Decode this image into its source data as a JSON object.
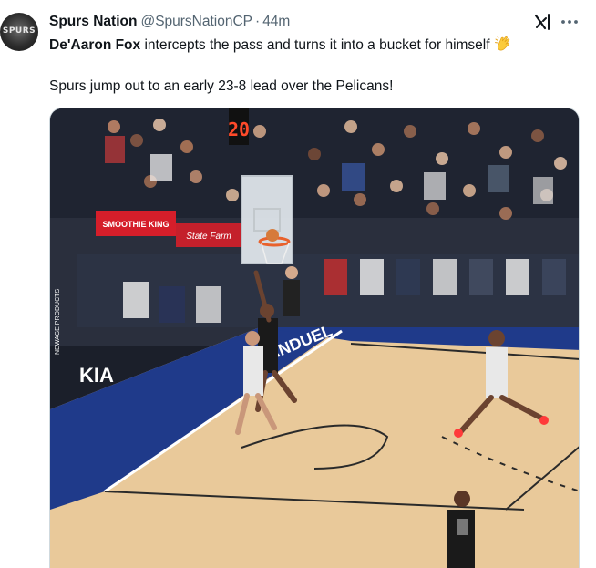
{
  "author": {
    "display_name": "Spurs Nation",
    "handle": "@SpursNationCP",
    "separator": "·",
    "time": "44m",
    "avatar_text": "SPURS"
  },
  "tweet": {
    "line1_bold": "De'Aaron Fox",
    "line1_rest": " intercepts the pass and turns it into a bucket for himself",
    "line2": "Spurs jump out to an early 23-8 lead over the Pelicans!"
  },
  "icons": {
    "grok": "grok-icon",
    "more": "more-options-icon",
    "clap": "clapping-hands-icon"
  },
  "media": {
    "shot_clock": "20",
    "sponsor_smoothie": "SMOOTHIE KING",
    "sponsor_statefarm": "State Farm",
    "court_brand_left": "NEWAGE PRODUCTS",
    "court_brand_kia": "KIA",
    "court_text_fanduel": "FANDUEL"
  },
  "colors": {
    "name_text": "#0f1419",
    "muted_text": "#536471",
    "media_border": "#cfd9de"
  }
}
